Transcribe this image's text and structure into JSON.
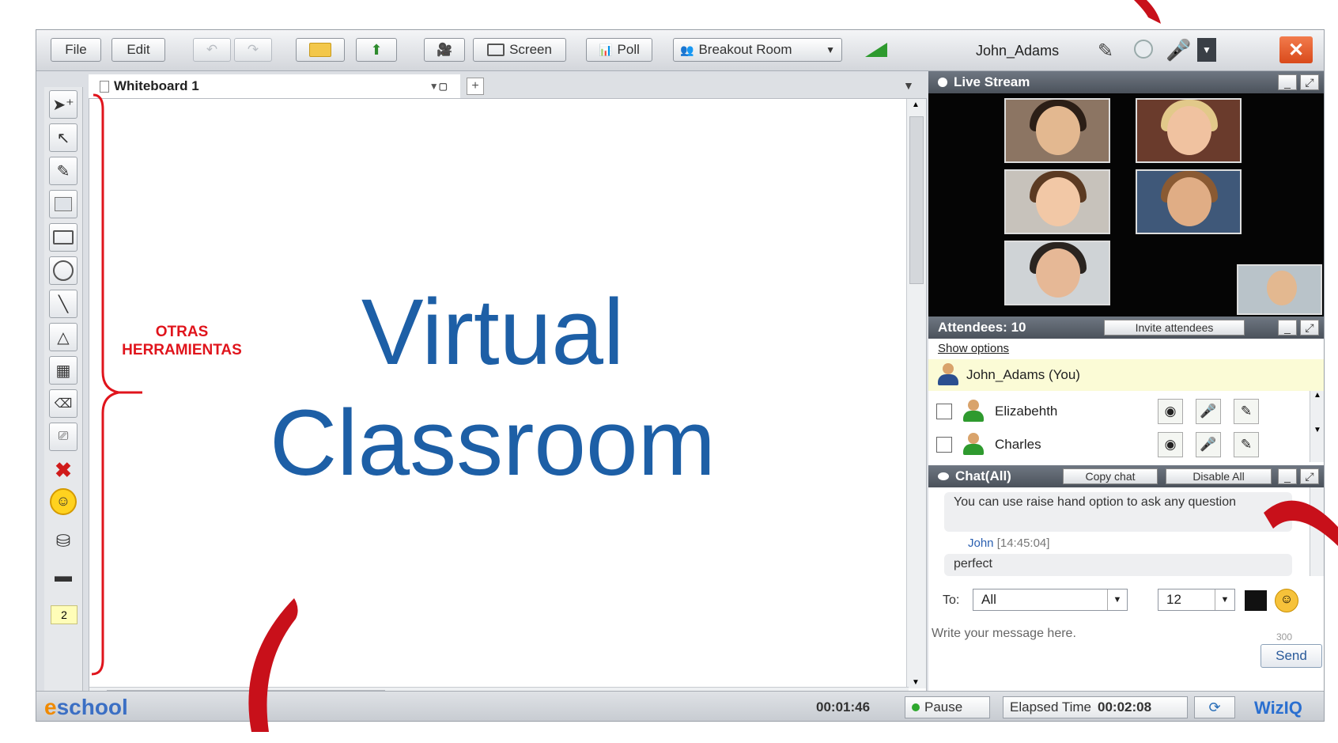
{
  "toolbar": {
    "file": "File",
    "edit": "Edit",
    "screen": "Screen",
    "poll": "Poll",
    "breakout": "Breakout Room",
    "user": "John_Adams"
  },
  "whiteboard": {
    "tab": "Whiteboard 1",
    "line1": "Virtual",
    "line2": "Classroom",
    "page": "2"
  },
  "live_stream": {
    "title": "Live Stream"
  },
  "attendees": {
    "title": "Attendees: 10",
    "invite": "Invite attendees",
    "show_options": "Show options",
    "me": "John_Adams (You)",
    "list": [
      "Elizabehth",
      "Charles"
    ]
  },
  "chat": {
    "title": "Chat(All)",
    "copy": "Copy chat",
    "disable": "Disable All",
    "message1": "You can use raise hand option to ask any question",
    "sender": "John",
    "time": "[14:45:04]",
    "message2": "perfect",
    "to_label": "To:",
    "to_value": "All",
    "font_size": "12",
    "placeholder": "Write your message here.",
    "counter": "300",
    "send": "Send"
  },
  "status": {
    "brand_prefix": "e",
    "brand_rest": "school",
    "timer": "00:01:46",
    "pause": "Pause",
    "elapsed_label": "Elapsed Time",
    "elapsed_value": "00:02:08",
    "logo": "WizIQ"
  },
  "annotation": {
    "line1": "OTRAS",
    "line2": "HERRAMIENTAS"
  },
  "colors": {
    "accent_red": "#e0141c",
    "title_blue": "#1d5fa6"
  },
  "icons": [
    "select-add-icon",
    "pointer-icon",
    "pen-icon",
    "image-icon",
    "rectangle-icon",
    "ellipse-icon",
    "line-icon",
    "triangle-icon",
    "table-icon",
    "eraser-icon",
    "clear-icon",
    "delete-icon",
    "emoticon-icon",
    "stamp-icon",
    "highlighter-icon"
  ]
}
